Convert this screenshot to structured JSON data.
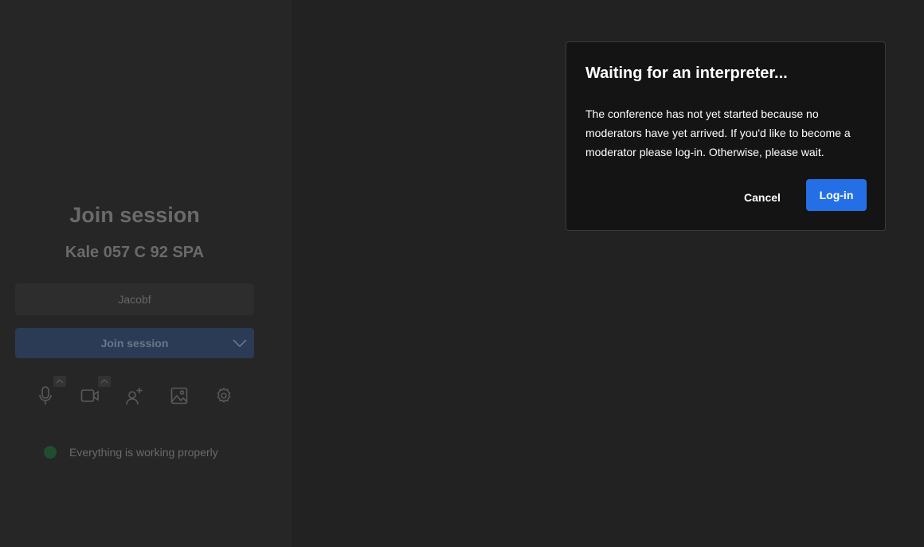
{
  "prejoin": {
    "title": "Join session",
    "room_name": "Kale 057 C 92 SPA",
    "name_input": {
      "value": "Jacobf",
      "placeholder": ""
    },
    "join_button": {
      "label": "Join session",
      "dropdown_icon": "chevron-down-icon"
    },
    "toolbar": [
      {
        "icon": "microphone-icon",
        "has_options": true
      },
      {
        "icon": "video-camera-icon",
        "has_options": true
      },
      {
        "icon": "invite-person-icon",
        "has_options": false
      },
      {
        "icon": "virtual-background-icon",
        "has_options": false
      },
      {
        "icon": "settings-gear-icon",
        "has_options": false
      }
    ],
    "status": {
      "text": "Everything is working properly",
      "color": "#1f4d2e"
    }
  },
  "dialog": {
    "title": "Waiting for an interpreter...",
    "body": "The conference has not yet started because no moderators have yet arrived. If you'd like to become a moderator please log-in. Otherwise, please wait.",
    "cancel_label": "Cancel",
    "login_label": "Log-in",
    "accent_color": "#246fe5"
  }
}
